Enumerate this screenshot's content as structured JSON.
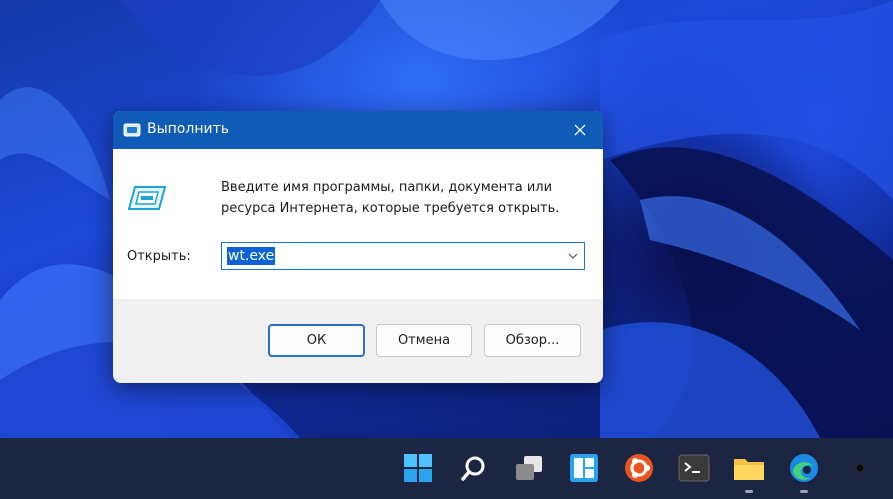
{
  "dialog": {
    "title": "Выполнить",
    "description_line1": "Введите имя программы, папки, документа или",
    "description_line2": "ресурса Интернета, которые требуется открыть.",
    "open_label": "Открыть:",
    "open_value": "wt.exe",
    "buttons": {
      "ok": "ОК",
      "cancel": "Отмена",
      "browse": "Обзор..."
    }
  },
  "taskbar": {
    "icons": [
      "start-icon",
      "search-icon",
      "task-view-icon",
      "widgets-icon",
      "ubuntu-icon",
      "terminal-icon",
      "file-explorer-icon",
      "edge-icon",
      "camera-icon"
    ]
  },
  "colors": {
    "titlebar": "#0f5bb5",
    "accent": "#0b63d6",
    "taskbar": "#1c2642"
  }
}
